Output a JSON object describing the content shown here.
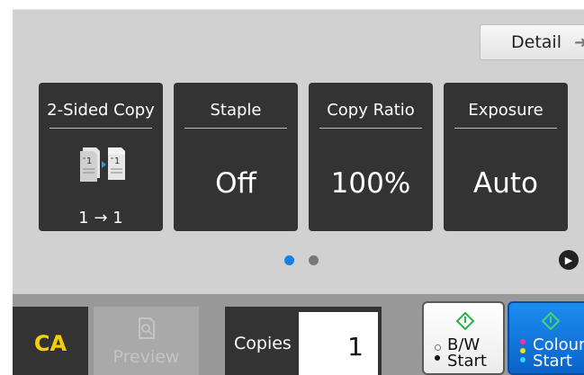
{
  "toolbar": {
    "detail_label": "Detail",
    "detail_arrow": "➜"
  },
  "tiles": [
    {
      "title": "2-Sided Copy",
      "value": "",
      "sub": "1 → 1",
      "icon": "two-sided-copy-icon"
    },
    {
      "title": "Staple",
      "value": "Off"
    },
    {
      "title": "Copy Ratio",
      "value": "100%"
    },
    {
      "title": "Exposure",
      "value": "Auto"
    }
  ],
  "pager": {
    "current_page": 1,
    "total_pages": 2,
    "active_color": "#1b7fe0",
    "inactive_color": "#777777",
    "next_icon": "play-icon"
  },
  "bottom": {
    "ca_label": "CA",
    "preview_label": "Preview",
    "copies_label": "Copies",
    "copies_value": "1",
    "bw_label_line1": "B/W",
    "bw_label_line2": "Start",
    "colour_label_line1": "Colour",
    "colour_label_line2": "Start"
  },
  "colors": {
    "background": "#d1d1d1",
    "tile": "#333333",
    "bottom_bar": "#999999",
    "ca_text": "#f5d000",
    "start_icon": "#28b34b",
    "colour_button": "#1479de"
  }
}
